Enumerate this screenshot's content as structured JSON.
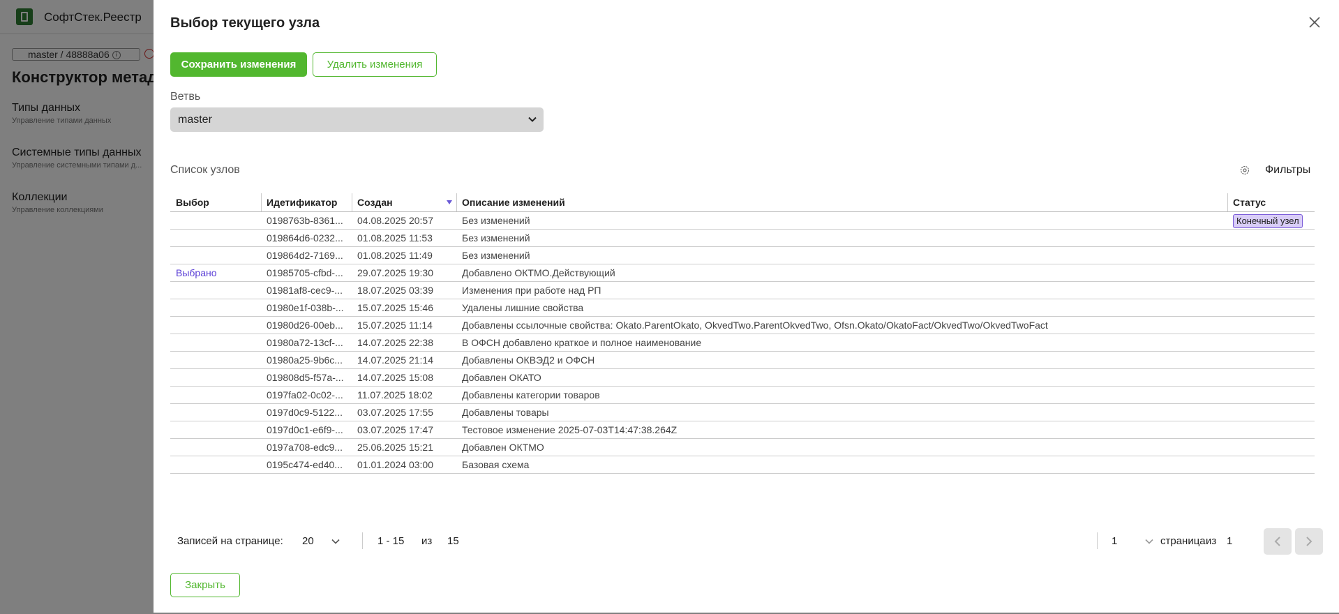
{
  "app": {
    "title": "СофтСтек.Реестр",
    "branch_chip": "master / 48888a06",
    "page_title": "Конструктор метада...",
    "nav": [
      {
        "label": "Типы данных",
        "sub": "Управление типами данных"
      },
      {
        "label": "Системные типы данных",
        "sub": "Управление системными типами д..."
      },
      {
        "label": "Коллекции",
        "sub": "Управление коллекциями"
      }
    ]
  },
  "dialog": {
    "title": "Выбор текущего узла",
    "save_label": "Сохранить изменения",
    "discard_label": "Удалить изменения",
    "branch_label": "Ветвь",
    "branch_value": "master",
    "nodes_label": "Список узлов",
    "filters_label": "Фильтры",
    "close_label": "Закрыть"
  },
  "table": {
    "headers": [
      "Выбор",
      "Идетификатор",
      "Создан",
      "Описание изменений",
      "Статус"
    ],
    "rows": [
      {
        "select": "",
        "id": "0198763b-8361...",
        "created": "04.08.2025 20:57",
        "desc": "Без изменений",
        "status": "Конечный узел"
      },
      {
        "select": "",
        "id": "019864d6-0232...",
        "created": "01.08.2025 11:53",
        "desc": "Без изменений",
        "status": ""
      },
      {
        "select": "",
        "id": "019864d2-7169...",
        "created": "01.08.2025 11:49",
        "desc": "Без изменений",
        "status": ""
      },
      {
        "select": "Выбрано",
        "id": "01985705-cfbd-...",
        "created": "29.07.2025 19:30",
        "desc": "Добавлено ОКТМО.Действующий",
        "status": ""
      },
      {
        "select": "",
        "id": "01981af8-cec9-...",
        "created": "18.07.2025 03:39",
        "desc": "Изменения при работе над РП",
        "status": ""
      },
      {
        "select": "",
        "id": "01980e1f-038b-...",
        "created": "15.07.2025 15:46",
        "desc": "Удалены лишние свойства",
        "status": ""
      },
      {
        "select": "",
        "id": "01980d26-00eb...",
        "created": "15.07.2025 11:14",
        "desc": "Добавлены ссылочные свойства: Okato.ParentOkato, OkvedTwo.ParentOkvedTwo, Ofsn.Okato/OkatoFact/OkvedTwo/OkvedTwoFact",
        "status": ""
      },
      {
        "select": "",
        "id": "01980a72-13cf-...",
        "created": "14.07.2025 22:38",
        "desc": "В ОФСН добавлено краткое и полное наименование",
        "status": ""
      },
      {
        "select": "",
        "id": "01980a25-9b6c...",
        "created": "14.07.2025 21:14",
        "desc": "Добавлены ОКВЭД2 и ОФСН",
        "status": ""
      },
      {
        "select": "",
        "id": "019808d5-f57a-...",
        "created": "14.07.2025 15:08",
        "desc": "Добавлен ОКАТО",
        "status": ""
      },
      {
        "select": "",
        "id": "0197fa02-0c02-...",
        "created": "11.07.2025 18:02",
        "desc": "Добавлены категории товаров",
        "status": ""
      },
      {
        "select": "",
        "id": "0197d0c9-5122...",
        "created": "03.07.2025 17:55",
        "desc": "Добавлены товары",
        "status": ""
      },
      {
        "select": "",
        "id": "0197d0c1-e6f9-...",
        "created": "03.07.2025 17:47",
        "desc": "Тестовое изменение 2025-07-03T14:47:38.264Z",
        "status": ""
      },
      {
        "select": "",
        "id": "0197a708-edc9...",
        "created": "25.06.2025 15:21",
        "desc": "Добавлен ОКТМО",
        "status": ""
      },
      {
        "select": "",
        "id": "0195c474-ed40...",
        "created": "01.01.2024 03:00",
        "desc": "Базовая схема",
        "status": ""
      }
    ]
  },
  "pagination": {
    "per_page_label": "Записей на странице:",
    "per_page": "20",
    "range": "1 - 15",
    "of": "из",
    "total": "15",
    "page": "1",
    "page_word": "страница",
    "pages_total": "1"
  },
  "colors": {
    "accent": "#52b72f",
    "selected": "#5b3fd6",
    "badge_bg": "#d9cdf7"
  },
  "icons": [
    "logo-icon",
    "info-icon",
    "warning-icon",
    "close-icon",
    "chevron-down-icon",
    "sort-desc-icon",
    "gear-icon",
    "chevron-left-icon",
    "chevron-right-icon"
  ]
}
